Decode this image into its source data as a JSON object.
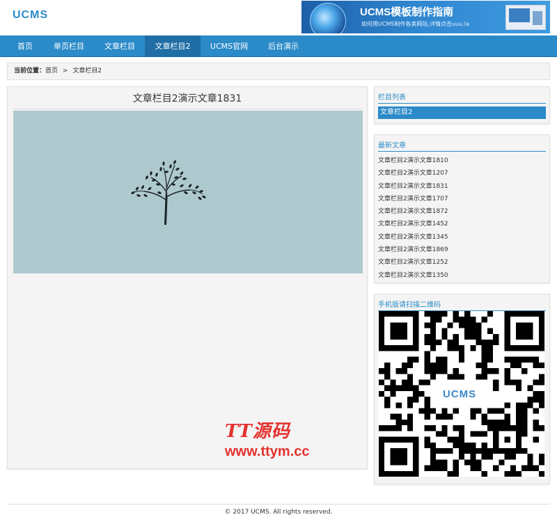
{
  "site": {
    "logo": "UCMS",
    "banner_title": "UCMS模板制作指南",
    "banner_subtitle": "如何用UCMS制作各类网站,详情点击uuu.la"
  },
  "nav": [
    {
      "label": "首页",
      "active": false
    },
    {
      "label": "单页栏目",
      "active": false
    },
    {
      "label": "文章栏目",
      "active": false
    },
    {
      "label": "文章栏目2",
      "active": true
    },
    {
      "label": "UCMS官网",
      "active": false
    },
    {
      "label": "后台演示",
      "active": false
    }
  ],
  "breadcrumb": {
    "prefix": "当前位置：",
    "home": "首页",
    "separator": ">",
    "current": "文章栏目2"
  },
  "article": {
    "title": "文章栏目2演示文章1831",
    "image_icon": "tree-icon"
  },
  "watermark": {
    "line1": "TT源码",
    "line2": "www.ttym.cc"
  },
  "sidebar": {
    "categories_title": "栏目列表",
    "categories": [
      "文章栏目2"
    ],
    "latest_title": "最新文章",
    "latest": [
      "文章栏目2演示文章1810",
      "文章栏目2演示文章1207",
      "文章栏目2演示文章1831",
      "文章栏目2演示文章1707",
      "文章栏目2演示文章1872",
      "文章栏目2演示文章1452",
      "文章栏目2演示文章1345",
      "文章栏目2演示文章1869",
      "文章栏目2演示文章1252",
      "文章栏目2演示文章1350"
    ],
    "qr_title": "手机版请扫描二维码",
    "qr_label": "UCMS"
  },
  "footer": {
    "copyright": "© 2017 UCMS. All rights reserved."
  },
  "colors": {
    "primary": "#2b8ac8",
    "primary_dark": "#1f6ea6",
    "panel_bg": "#f4f4f4",
    "image_bg": "#aec9ce",
    "watermark": "#e4322f"
  }
}
